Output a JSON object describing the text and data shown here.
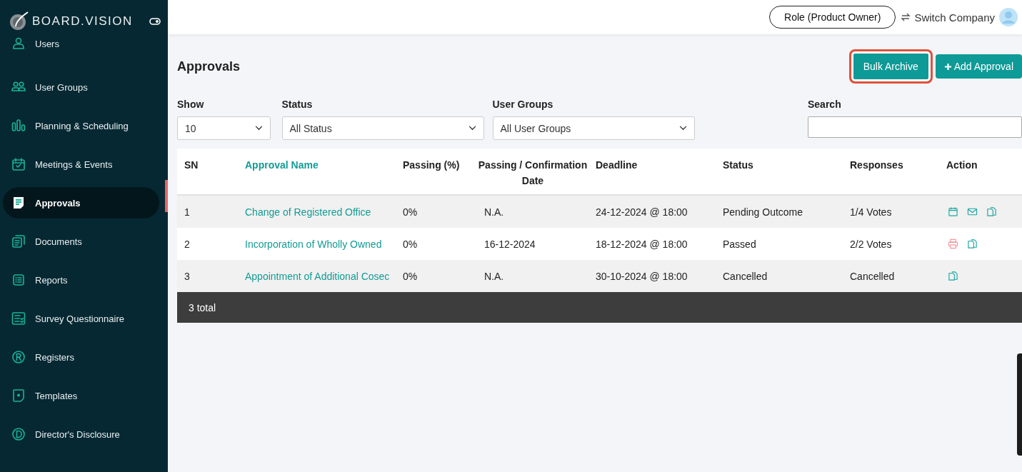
{
  "sidebar": {
    "brand": "BOARD.VISION",
    "items": [
      {
        "label": "Users",
        "kind": "user",
        "selected": false
      },
      {
        "label": "User Groups",
        "kind": "users",
        "selected": false
      },
      {
        "label": "Planning & Scheduling",
        "kind": "bars",
        "selected": false
      },
      {
        "label": "Meetings & Events",
        "kind": "calendar",
        "selected": false
      },
      {
        "label": "Approvals",
        "kind": "note",
        "selected": true
      },
      {
        "label": "Documents",
        "kind": "docs",
        "selected": false
      },
      {
        "label": "Reports",
        "kind": "list",
        "selected": false
      },
      {
        "label": "Survey Questionnaire",
        "kind": "survey",
        "selected": false
      },
      {
        "label": "Registers",
        "kind": "registered",
        "selected": false
      },
      {
        "label": "Templates",
        "kind": "template",
        "selected": false
      },
      {
        "label": "Director's Disclosure",
        "kind": "letter",
        "selected": false
      }
    ]
  },
  "header": {
    "role": "Role (Product Owner)",
    "switch": "Switch Company"
  },
  "page": {
    "title": "Approvals",
    "buttons": [
      {
        "label": "Bulk Archive",
        "highlighted": true,
        "kind": "plain"
      },
      {
        "label": "Add Approval",
        "highlighted": false,
        "kind": "add"
      }
    ]
  },
  "filters": [
    {
      "label": "Show",
      "kind": "select",
      "value": "10"
    },
    {
      "label": "Status",
      "kind": "select",
      "value": "All Status"
    },
    {
      "label": "User Groups",
      "kind": "select",
      "value": "All User Groups"
    },
    {
      "label": "Search",
      "kind": "text"
    }
  ],
  "table": {
    "columns": [
      "SN",
      "Approval Name",
      "Passing (%)",
      "Passing / Confirmation Date",
      "Deadline",
      "Status",
      "Responses",
      "Action"
    ],
    "rows": [
      {
        "sn": "1",
        "name": "Change of Registered Office",
        "passing": "0%",
        "date": "N.A.",
        "deadline": "24-12-2024 @ 18:00",
        "status": "Pending Outcome",
        "responses": "1/4 Votes",
        "actions": [
          {
            "kind": "calendar"
          },
          {
            "kind": "mail"
          },
          {
            "kind": "copy"
          }
        ]
      },
      {
        "sn": "2",
        "name": "Incorporation of Wholly Owned",
        "passing": "0%",
        "date": "16-12-2024",
        "deadline": "18-12-2024 @ 18:00",
        "status": "Passed",
        "responses": "2/2 Votes",
        "actions": [
          {
            "kind": "print"
          },
          {
            "kind": "copy"
          }
        ]
      },
      {
        "sn": "3",
        "name": "Appointment of Additional Cosec",
        "passing": "0%",
        "date": "N.A.",
        "deadline": "30-10-2024 @ 18:00",
        "status": "Cancelled",
        "responses": "Cancelled",
        "actions": [
          {
            "kind": "copy"
          }
        ]
      }
    ],
    "footer": "3 total"
  }
}
